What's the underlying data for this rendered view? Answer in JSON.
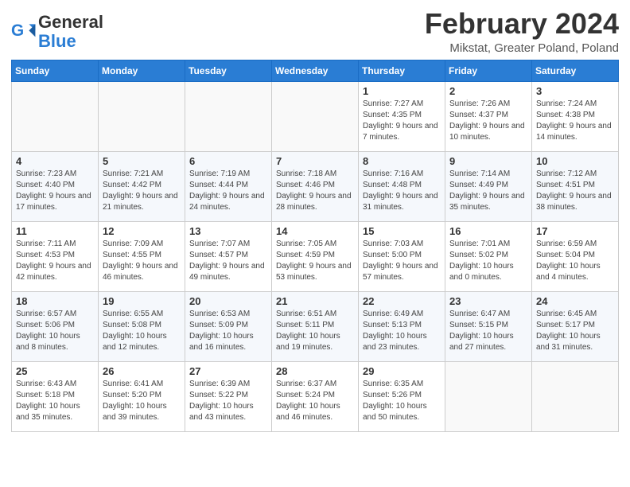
{
  "logo": {
    "line1": "General",
    "line2": "Blue"
  },
  "title": "February 2024",
  "subtitle": "Mikstat, Greater Poland, Poland",
  "weekdays": [
    "Sunday",
    "Monday",
    "Tuesday",
    "Wednesday",
    "Thursday",
    "Friday",
    "Saturday"
  ],
  "weeks": [
    [
      {
        "day": "",
        "info": ""
      },
      {
        "day": "",
        "info": ""
      },
      {
        "day": "",
        "info": ""
      },
      {
        "day": "",
        "info": ""
      },
      {
        "day": "1",
        "info": "Sunrise: 7:27 AM\nSunset: 4:35 PM\nDaylight: 9 hours and 7 minutes."
      },
      {
        "day": "2",
        "info": "Sunrise: 7:26 AM\nSunset: 4:37 PM\nDaylight: 9 hours and 10 minutes."
      },
      {
        "day": "3",
        "info": "Sunrise: 7:24 AM\nSunset: 4:38 PM\nDaylight: 9 hours and 14 minutes."
      }
    ],
    [
      {
        "day": "4",
        "info": "Sunrise: 7:23 AM\nSunset: 4:40 PM\nDaylight: 9 hours and 17 minutes."
      },
      {
        "day": "5",
        "info": "Sunrise: 7:21 AM\nSunset: 4:42 PM\nDaylight: 9 hours and 21 minutes."
      },
      {
        "day": "6",
        "info": "Sunrise: 7:19 AM\nSunset: 4:44 PM\nDaylight: 9 hours and 24 minutes."
      },
      {
        "day": "7",
        "info": "Sunrise: 7:18 AM\nSunset: 4:46 PM\nDaylight: 9 hours and 28 minutes."
      },
      {
        "day": "8",
        "info": "Sunrise: 7:16 AM\nSunset: 4:48 PM\nDaylight: 9 hours and 31 minutes."
      },
      {
        "day": "9",
        "info": "Sunrise: 7:14 AM\nSunset: 4:49 PM\nDaylight: 9 hours and 35 minutes."
      },
      {
        "day": "10",
        "info": "Sunrise: 7:12 AM\nSunset: 4:51 PM\nDaylight: 9 hours and 38 minutes."
      }
    ],
    [
      {
        "day": "11",
        "info": "Sunrise: 7:11 AM\nSunset: 4:53 PM\nDaylight: 9 hours and 42 minutes."
      },
      {
        "day": "12",
        "info": "Sunrise: 7:09 AM\nSunset: 4:55 PM\nDaylight: 9 hours and 46 minutes."
      },
      {
        "day": "13",
        "info": "Sunrise: 7:07 AM\nSunset: 4:57 PM\nDaylight: 9 hours and 49 minutes."
      },
      {
        "day": "14",
        "info": "Sunrise: 7:05 AM\nSunset: 4:59 PM\nDaylight: 9 hours and 53 minutes."
      },
      {
        "day": "15",
        "info": "Sunrise: 7:03 AM\nSunset: 5:00 PM\nDaylight: 9 hours and 57 minutes."
      },
      {
        "day": "16",
        "info": "Sunrise: 7:01 AM\nSunset: 5:02 PM\nDaylight: 10 hours and 0 minutes."
      },
      {
        "day": "17",
        "info": "Sunrise: 6:59 AM\nSunset: 5:04 PM\nDaylight: 10 hours and 4 minutes."
      }
    ],
    [
      {
        "day": "18",
        "info": "Sunrise: 6:57 AM\nSunset: 5:06 PM\nDaylight: 10 hours and 8 minutes."
      },
      {
        "day": "19",
        "info": "Sunrise: 6:55 AM\nSunset: 5:08 PM\nDaylight: 10 hours and 12 minutes."
      },
      {
        "day": "20",
        "info": "Sunrise: 6:53 AM\nSunset: 5:09 PM\nDaylight: 10 hours and 16 minutes."
      },
      {
        "day": "21",
        "info": "Sunrise: 6:51 AM\nSunset: 5:11 PM\nDaylight: 10 hours and 19 minutes."
      },
      {
        "day": "22",
        "info": "Sunrise: 6:49 AM\nSunset: 5:13 PM\nDaylight: 10 hours and 23 minutes."
      },
      {
        "day": "23",
        "info": "Sunrise: 6:47 AM\nSunset: 5:15 PM\nDaylight: 10 hours and 27 minutes."
      },
      {
        "day": "24",
        "info": "Sunrise: 6:45 AM\nSunset: 5:17 PM\nDaylight: 10 hours and 31 minutes."
      }
    ],
    [
      {
        "day": "25",
        "info": "Sunrise: 6:43 AM\nSunset: 5:18 PM\nDaylight: 10 hours and 35 minutes."
      },
      {
        "day": "26",
        "info": "Sunrise: 6:41 AM\nSunset: 5:20 PM\nDaylight: 10 hours and 39 minutes."
      },
      {
        "day": "27",
        "info": "Sunrise: 6:39 AM\nSunset: 5:22 PM\nDaylight: 10 hours and 43 minutes."
      },
      {
        "day": "28",
        "info": "Sunrise: 6:37 AM\nSunset: 5:24 PM\nDaylight: 10 hours and 46 minutes."
      },
      {
        "day": "29",
        "info": "Sunrise: 6:35 AM\nSunset: 5:26 PM\nDaylight: 10 hours and 50 minutes."
      },
      {
        "day": "",
        "info": ""
      },
      {
        "day": "",
        "info": ""
      }
    ]
  ]
}
